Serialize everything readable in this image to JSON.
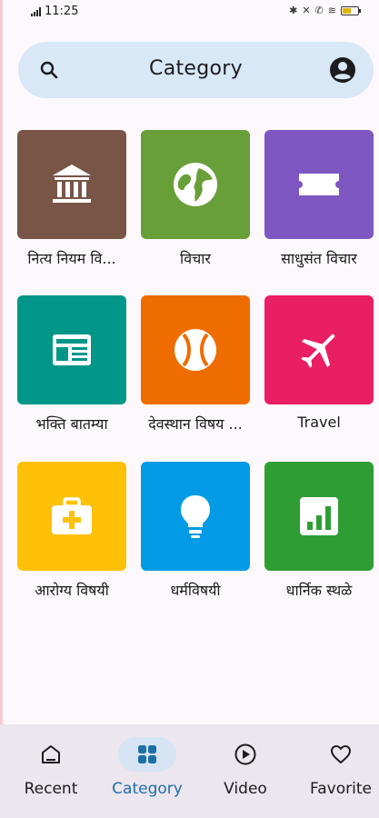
{
  "status_bar": {
    "time": "11:25",
    "battery_percent": 55
  },
  "search": {
    "title": "Category",
    "search_icon": "search-icon",
    "account_icon": "account-circle-icon"
  },
  "categories": [
    {
      "label": "नित्य नियम वि...",
      "icon": "bank-icon",
      "color": "#795548"
    },
    {
      "label": "विचार",
      "icon": "globe-icon",
      "color": "#689f38"
    },
    {
      "label": "साधुसंत विचार",
      "icon": "ticket-icon",
      "color": "#7e57c2"
    },
    {
      "label": "भक्ति बातम्या",
      "icon": "newspaper-icon",
      "color": "#009688"
    },
    {
      "label": "देवस्थान विषय ...",
      "icon": "sports-ball-icon",
      "color": "#ef6c00"
    },
    {
      "label": "Travel",
      "icon": "airplane-icon",
      "color": "#e91e63"
    },
    {
      "label": "आरोग्य विषयी",
      "icon": "medical-bag-icon",
      "color": "#ffc107"
    },
    {
      "label": "धर्मविषयी",
      "icon": "lightbulb-icon",
      "color": "#039be5"
    },
    {
      "label": "धार्निक स्थळे",
      "icon": "bar-chart-icon",
      "color": "#2e9e34"
    }
  ],
  "bottom_nav": {
    "active": "Category",
    "items": [
      {
        "label": "Recent",
        "icon": "home-icon"
      },
      {
        "label": "Category",
        "icon": "grid-icon"
      },
      {
        "label": "Video",
        "icon": "play-circle-icon"
      },
      {
        "label": "Favorite",
        "icon": "heart-icon"
      }
    ]
  }
}
